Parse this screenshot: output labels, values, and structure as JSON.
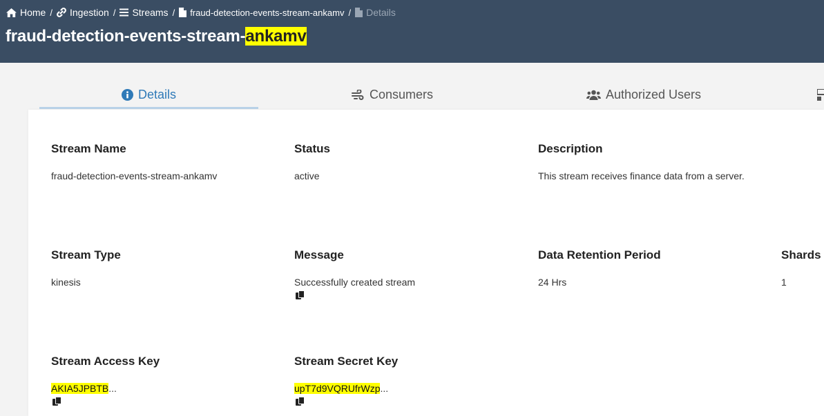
{
  "breadcrumb": {
    "home": "Home",
    "ingestion": "Ingestion",
    "streams": "Streams",
    "stream": "fraud-detection-events-stream-ankamv",
    "current": "Details",
    "separator": "/"
  },
  "title": {
    "prefix": "fraud-detection-events-stream-",
    "highlight": "ankamv"
  },
  "tabs": [
    {
      "label": "Details",
      "icon": "info-circle-icon"
    },
    {
      "label": "Consumers",
      "icon": "wind-icon"
    },
    {
      "label": "Authorized Users",
      "icon": "users-icon"
    }
  ],
  "fields": {
    "stream_name": {
      "label": "Stream Name",
      "value": "fraud-detection-events-stream-ankamv"
    },
    "status": {
      "label": "Status",
      "value": "active"
    },
    "description": {
      "label": "Description",
      "value": "This stream receives finance data from a server."
    },
    "stream_type": {
      "label": "Stream Type",
      "value": "kinesis"
    },
    "message": {
      "label": "Message",
      "value": "Successfully created stream"
    },
    "retention": {
      "label": "Data Retention Period",
      "value": "24 Hrs"
    },
    "shards": {
      "label": "Shards",
      "value": "1"
    },
    "access_key": {
      "label": "Stream Access Key",
      "value": "AKIA5JPBTB",
      "ellipsis": "..."
    },
    "secret_key": {
      "label": "Stream Secret Key",
      "value": "upT7d9VQRUfrWzp",
      "ellipsis": "..."
    }
  },
  "colors": {
    "header_bg": "#3a4d63",
    "active_tab": "#2f7ab8",
    "highlight": "#ffff00"
  }
}
